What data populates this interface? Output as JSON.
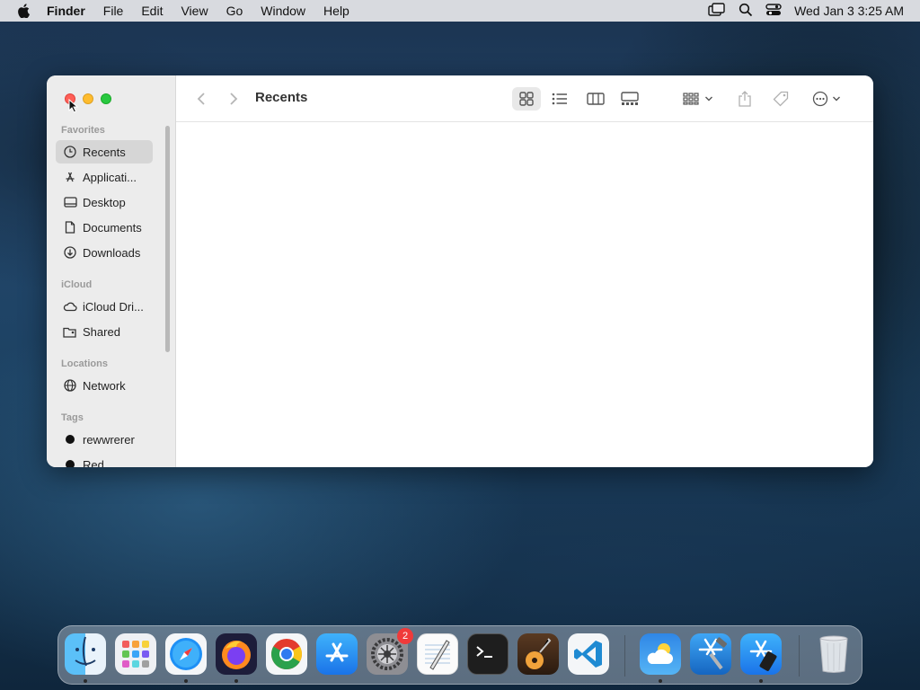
{
  "menubar": {
    "app_name": "Finder",
    "items": [
      "File",
      "Edit",
      "View",
      "Go",
      "Window",
      "Help"
    ],
    "datetime": "Wed Jan 3  3:25 AM"
  },
  "finder": {
    "title": "Recents",
    "sidebar": {
      "favorites_header": "Favorites",
      "favorites": [
        "Recents",
        "Applicati...",
        "Desktop",
        "Documents",
        "Downloads"
      ],
      "icloud_header": "iCloud",
      "icloud": [
        "iCloud Dri...",
        "Shared"
      ],
      "locations_header": "Locations",
      "locations": [
        "Network"
      ],
      "tags_header": "Tags",
      "tags": [
        "rewwrerer",
        "Red"
      ]
    }
  },
  "dock": {
    "apps": [
      "Finder",
      "Launchpad",
      "Safari",
      "Firefox",
      "Chrome",
      "App Store",
      "System Preferences",
      "TextEdit",
      "Terminal",
      "GarageBand",
      "Visual Studio Code",
      "Weather",
      "Xcode",
      "Simulator",
      "Trash"
    ],
    "system_preferences_badge": "2"
  },
  "colors": {
    "accent": "#0a84ff",
    "close": "#ff5f57",
    "minimize": "#febc2e",
    "maximize": "#28c840"
  }
}
